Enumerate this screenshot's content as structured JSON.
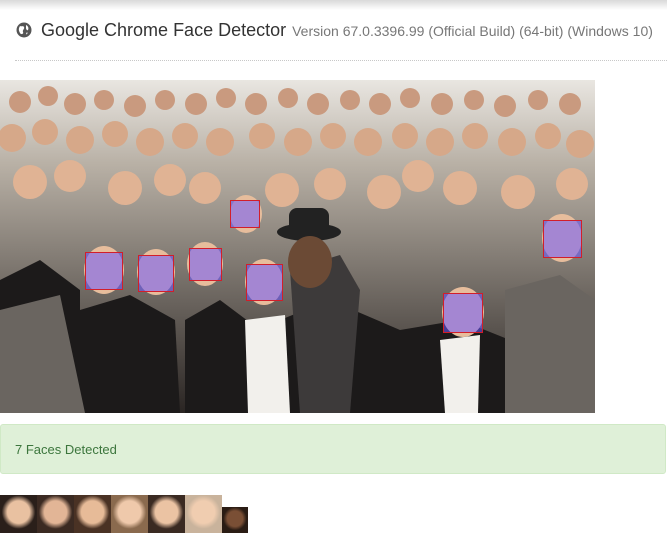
{
  "header": {
    "icon": "globe-icon",
    "title": "Google Chrome Face Detector",
    "version": "Version 67.0.3396.99 (Official Build) (64-bit) (Windows 10)"
  },
  "photo": {
    "description_icon": "group-photo",
    "detections": 7,
    "box_color": "#d21e2a",
    "box_fill": "#6e5aff"
  },
  "alert": {
    "text": "7 Faces Detected",
    "color": "#3c763d",
    "background": "#dff0d8"
  },
  "thumbnails": {
    "count": 7
  }
}
